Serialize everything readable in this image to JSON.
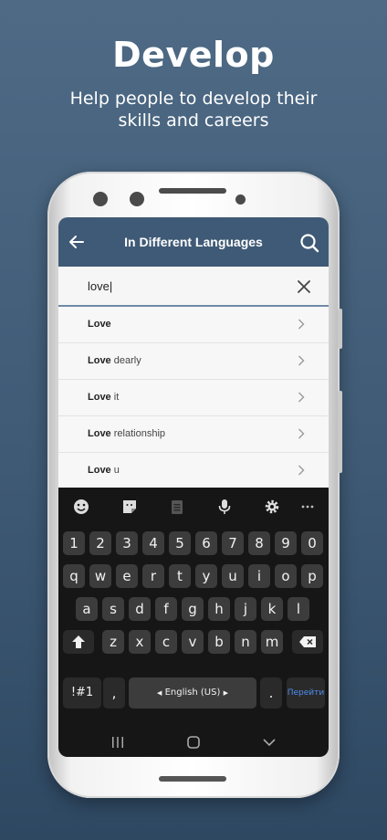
{
  "hero": {
    "title": "Develop",
    "subtitle": "Help people to develop their skills and careers"
  },
  "appbar": {
    "title": "In Different Languages",
    "back_icon": "arrow-back-icon",
    "search_icon": "search-icon"
  },
  "search": {
    "value": "love|",
    "clear_icon": "close-icon"
  },
  "suggestions": [
    {
      "bold": "Love",
      "rest": ""
    },
    {
      "bold": "Love",
      "rest": " dearly"
    },
    {
      "bold": "Love",
      "rest": " it"
    },
    {
      "bold": "Love",
      "rest": " relationship"
    },
    {
      "bold": "Love",
      "rest": " u"
    }
  ],
  "keyboard": {
    "toolbar_icons": [
      "emoji-icon",
      "sticker-icon",
      "clipboard-icon",
      "mic-icon",
      "settings-icon",
      "more-icon"
    ],
    "number_row": [
      "1",
      "2",
      "3",
      "4",
      "5",
      "6",
      "7",
      "8",
      "9",
      "0"
    ],
    "row1": [
      "q",
      "w",
      "e",
      "r",
      "t",
      "y",
      "u",
      "i",
      "o",
      "p"
    ],
    "row2": [
      "a",
      "s",
      "d",
      "f",
      "g",
      "h",
      "j",
      "k",
      "l"
    ],
    "row3": [
      "z",
      "x",
      "c",
      "v",
      "b",
      "n",
      "m"
    ],
    "symbols_label": "!#1",
    "comma_label": ",",
    "space_label": "English (US)",
    "period_label": ".",
    "action_label": "Перейти"
  },
  "navbar": {
    "icons": [
      "recent-apps-icon",
      "home-icon",
      "back-chevron-icon"
    ]
  },
  "colors": {
    "appbar": "#3f5a76",
    "background": "#4e6a85",
    "keyboard": "#161616",
    "action_key_text": "#4d8ef0"
  }
}
